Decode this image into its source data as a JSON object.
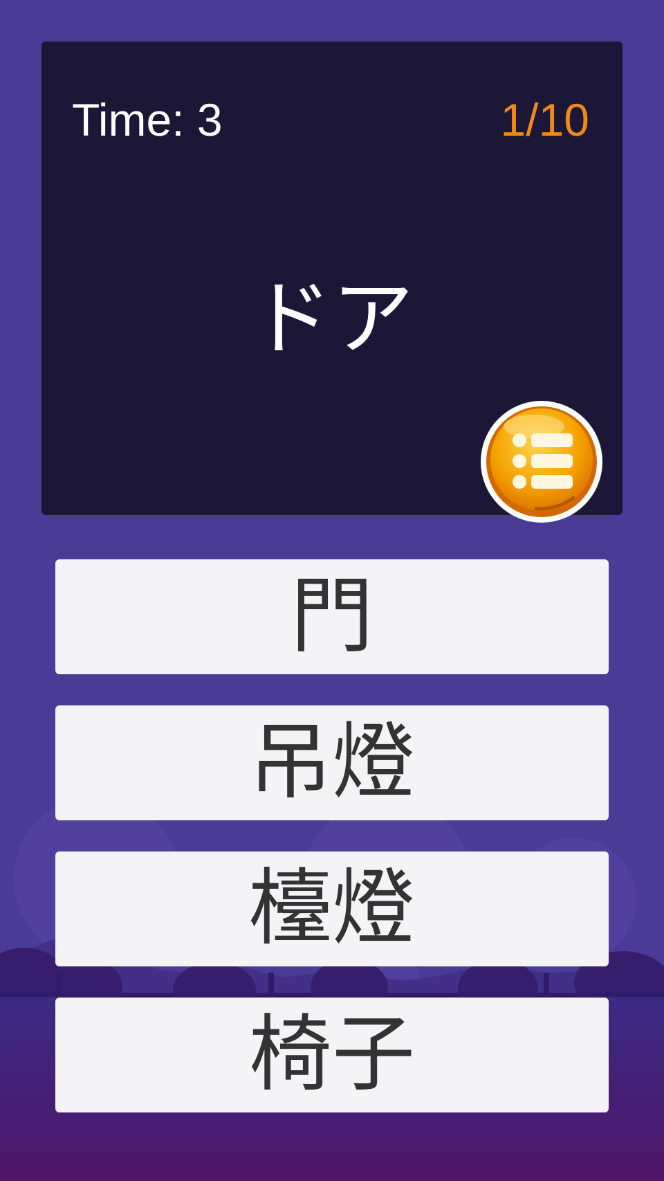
{
  "game": {
    "timer_text": "Time: 3",
    "progress_text": "1/10",
    "prompt_word": "ドア",
    "menu_icon": "list-menu-icon",
    "answers": [
      {
        "label": "門"
      },
      {
        "label": "吊燈"
      },
      {
        "label": "檯燈"
      },
      {
        "label": "椅子"
      }
    ]
  },
  "colors": {
    "background": "#4a3b96",
    "panel": "#1c1736",
    "progress": "#f08a16",
    "answer_background": "#f4f4f6",
    "answer_text": "#333333",
    "menu_button": "#f5a200"
  }
}
